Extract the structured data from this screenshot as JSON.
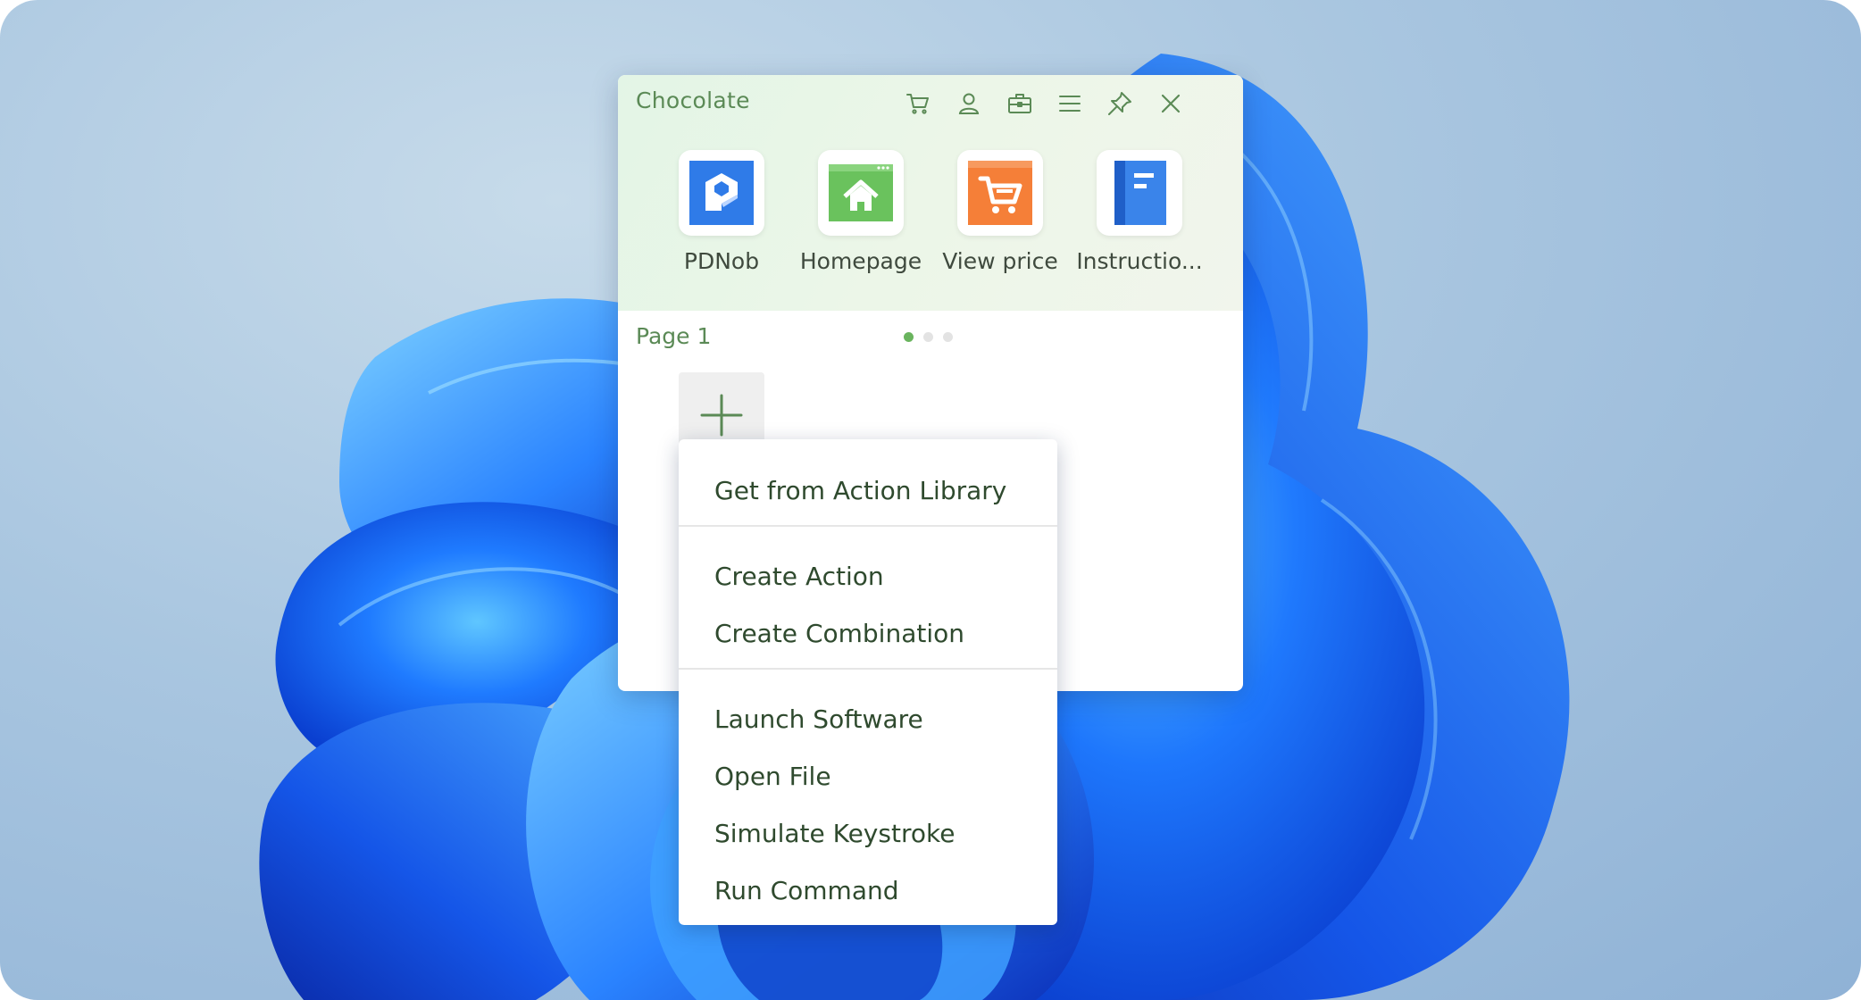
{
  "app": {
    "title": "Chocolate"
  },
  "toolbar": {
    "icons": [
      "cart-icon",
      "user-icon",
      "toolbox-icon",
      "menu-icon",
      "pin-icon",
      "close-icon"
    ]
  },
  "apps": [
    {
      "label": "PDNob",
      "icon": "pdnob-icon",
      "color": "#2f7be8"
    },
    {
      "label": "Homepage",
      "icon": "home-icon",
      "color": "#6ac25d"
    },
    {
      "label": "View price",
      "icon": "shopping-cart-icon",
      "color": "#f57f38"
    },
    {
      "label": "Instructio...",
      "icon": "book-icon",
      "color": "#3a84ea"
    }
  ],
  "page": {
    "label": "Page 1",
    "dots": 3,
    "active_dot": 0
  },
  "context_menu": {
    "items": [
      "Get from Action Library",
      "Create Action",
      "Create Combination",
      "Launch Software",
      "Open File",
      "Simulate Keystroke",
      "Run Command"
    ]
  },
  "colors": {
    "accent": "#6ab45e",
    "title_text": "#5b8a56",
    "menu_text": "#2f4a2e"
  }
}
